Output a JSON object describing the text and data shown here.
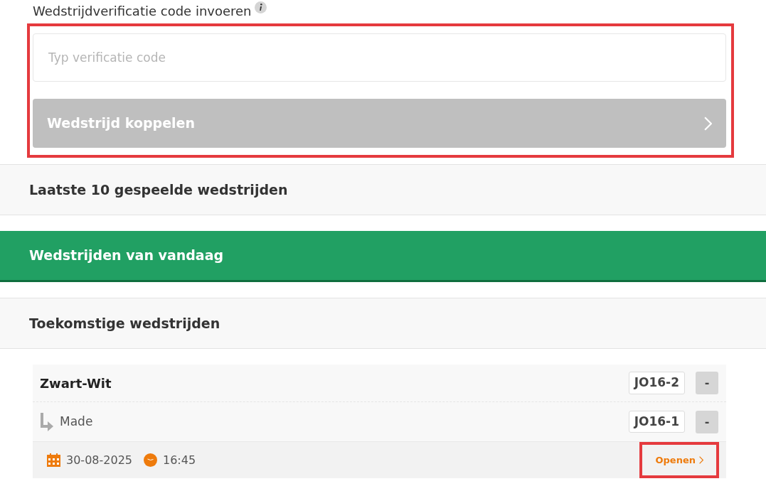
{
  "verification": {
    "label": "Wedstrijdverificatie code invoeren",
    "placeholder": "Typ verificatie code",
    "button": "Wedstrijd koppelen",
    "disabled": true,
    "highlighted": true
  },
  "sections": [
    {
      "title": "Laatste 10 gespeelde wedstrijden",
      "selected": false
    },
    {
      "title": "Wedstrijden van vandaag",
      "selected": true
    },
    {
      "title": "Toekomstige wedstrijden",
      "selected": false
    }
  ],
  "match": {
    "home": {
      "team": "Zwart-Wit",
      "category": "JO16-2",
      "score": "-"
    },
    "away": {
      "team": "Made",
      "category": "JO16-1",
      "score": "-"
    },
    "date": "30-08-2025",
    "time": "16:45",
    "open_link": "Openen",
    "open_highlighted": true
  }
}
